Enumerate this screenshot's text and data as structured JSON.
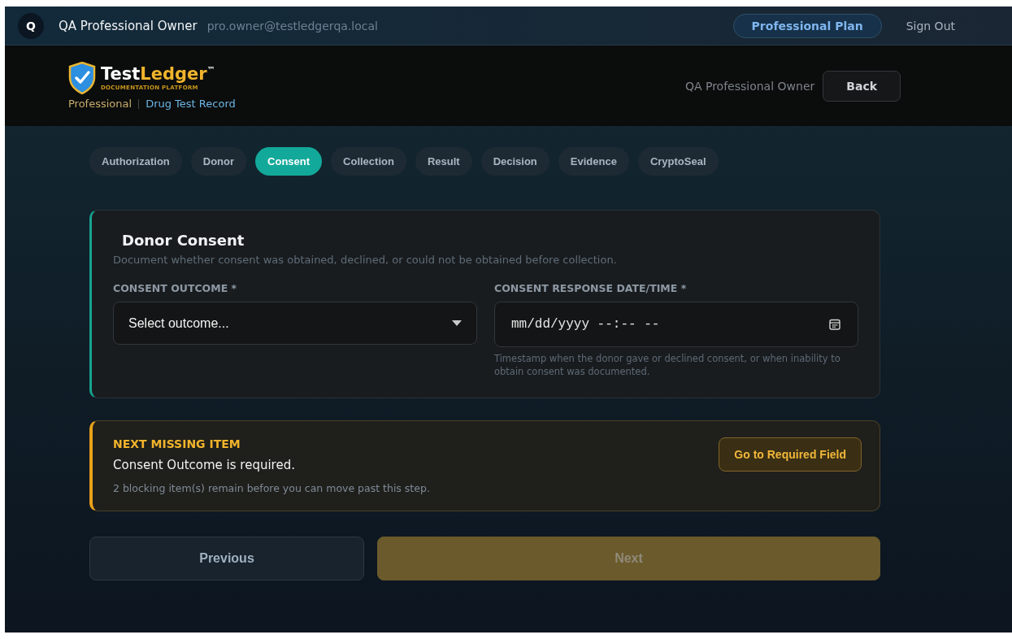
{
  "top_bar": {
    "avatar": "Q",
    "user_name": "QA Professional Owner",
    "email": "pro.owner@testledgerqa.local",
    "plan": "Professional Plan",
    "sign_out": "Sign Out"
  },
  "header": {
    "logo": {
      "first": "Test",
      "second": "Ledger",
      "mark": "™",
      "tagline": "DOCUMENTATION PLATFORM"
    },
    "tier": "Professional",
    "record": "Drug Test Record",
    "user": "QA Professional Owner",
    "back": "Back"
  },
  "tabs": [
    {
      "label": "Authorization",
      "selected": false
    },
    {
      "label": "Donor",
      "selected": false
    },
    {
      "label": "Consent",
      "selected": true
    },
    {
      "label": "Collection",
      "selected": false
    },
    {
      "label": "Result",
      "selected": false
    },
    {
      "label": "Decision",
      "selected": false
    },
    {
      "label": "Evidence",
      "selected": false
    },
    {
      "label": "CryptoSeal",
      "selected": false
    }
  ],
  "section": {
    "title": "Donor Consent",
    "description": "Document whether consent was obtained, declined, or could not be obtained before collection.",
    "fields": [
      {
        "kind": "select",
        "label": "CONSENT OUTCOME *",
        "value": "Select outcome..."
      },
      {
        "kind": "datetime",
        "label": "CONSENT RESPONSE DATE/TIME *",
        "value": "mm/dd/yyyy --:-- --",
        "hint": "Timestamp when the donor gave or declined consent, or when inability to obtain consent was documented."
      }
    ]
  },
  "missing": {
    "heading": "NEXT MISSING ITEM",
    "message": "Consent Outcome is required.",
    "detail": "2 blocking item(s) remain before you can move past this step.",
    "action": "Go to Required Field"
  },
  "nav": {
    "previous": {
      "label": "Previous",
      "disabled": false
    },
    "next": {
      "label": "Next",
      "disabled": true
    }
  }
}
